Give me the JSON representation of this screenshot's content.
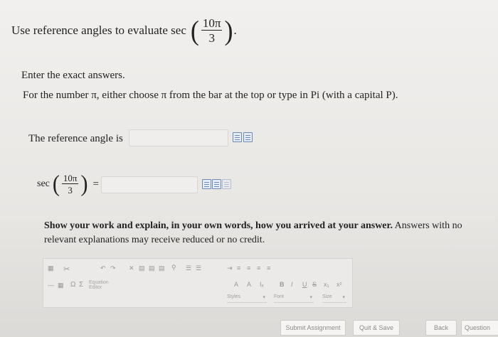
{
  "question": {
    "prefix": "Use reference angles to evaluate sec",
    "frac_num": "10π",
    "frac_den": "3",
    "suffix": "."
  },
  "instructions": {
    "line1": "Enter the exact answers.",
    "line2": "For the number π, either choose π from the bar at the top or type in Pi (with a capital P)."
  },
  "reference": {
    "label": "The reference angle is",
    "value": ""
  },
  "sec_answer": {
    "func": "sec",
    "frac_num": "10π",
    "frac_den": "3",
    "equals": "=",
    "value": ""
  },
  "work": {
    "bold_text": "Show your work and explain, in your own words, how you arrived at your answer.",
    "rest_text": " Answers with no relevant explanations may receive reduced or no credit."
  },
  "editor_toolbar": {
    "equation_editor_label": "Equation Editor",
    "omega": "Ω",
    "sigma": "Σ",
    "font_color": "A",
    "bg_color": "A",
    "clear_format": "Iₓ",
    "bold": "B",
    "italic": "I",
    "underline": "U",
    "strike": "S",
    "subscript": "x₁",
    "superscript": "x²",
    "styles_label": "Styles",
    "font_label": "Font",
    "size_label": "Size"
  },
  "buttons": {
    "submit": "Submit Assignment",
    "quit": "Quit & Save",
    "back": "Back",
    "question": "Question"
  }
}
